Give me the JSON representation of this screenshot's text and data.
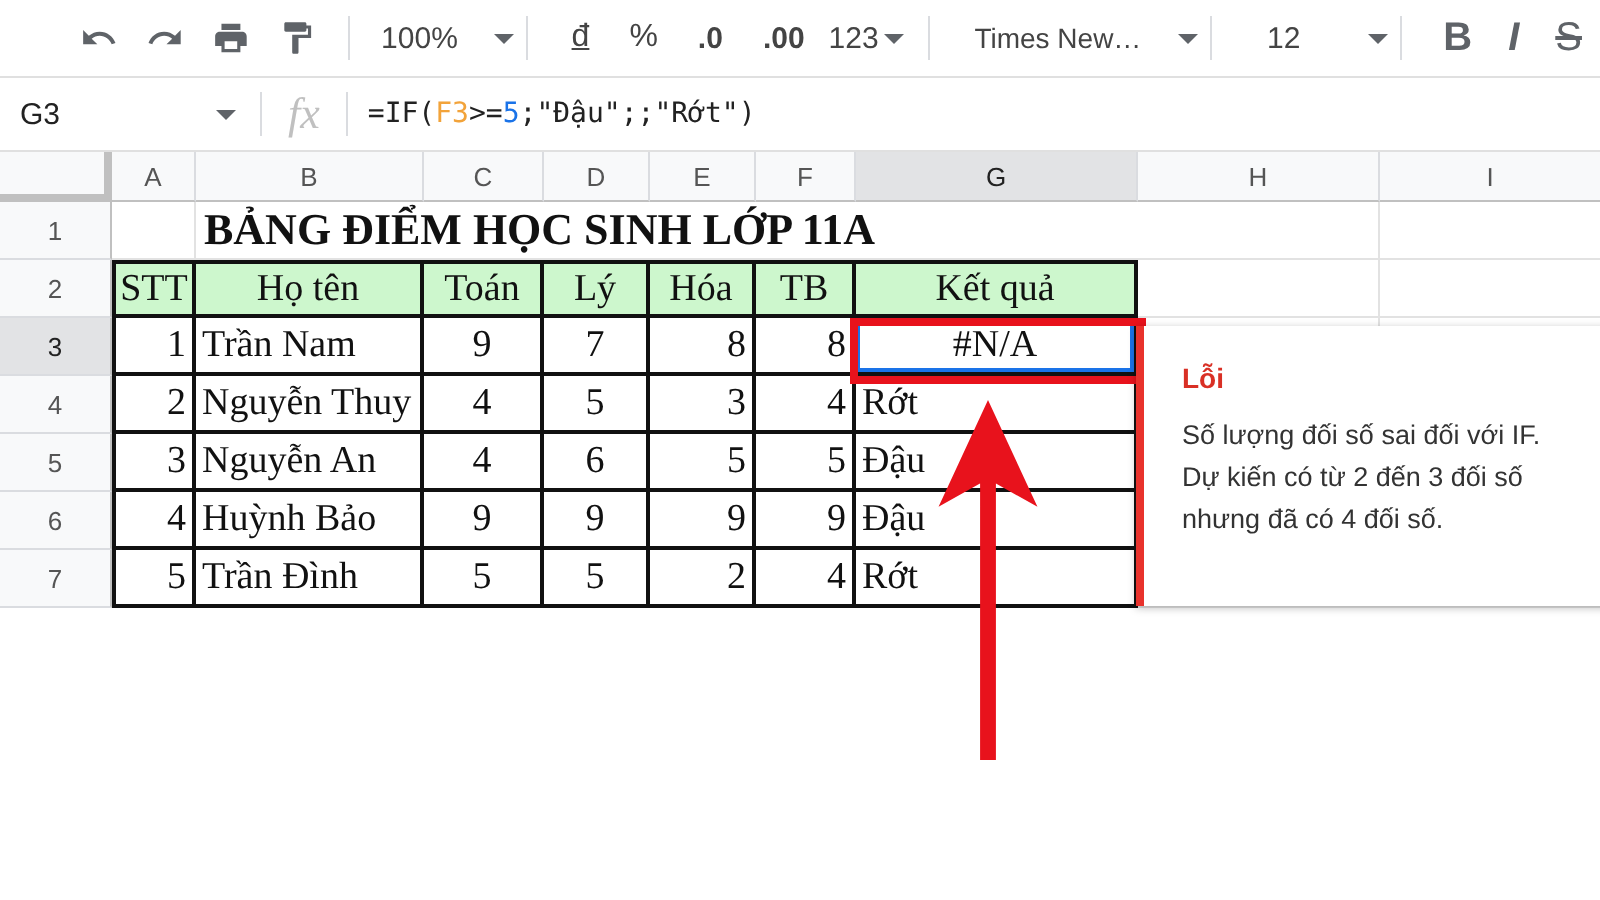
{
  "toolbar": {
    "zoom": "100%",
    "buttons": [
      {
        "label": "đ",
        "kind": "underline"
      },
      {
        "label": "%",
        "kind": "plain"
      },
      {
        "label": ".0",
        "kind": "decrease"
      },
      {
        "label": ".00",
        "kind": "increase"
      }
    ],
    "format": "123",
    "font": "Times New…",
    "size": "12",
    "styles": [
      {
        "label": "B",
        "kind": "bold"
      },
      {
        "label": "I",
        "kind": "italic"
      },
      {
        "label": "S",
        "kind": "strike"
      }
    ]
  },
  "formula_bar": {
    "name_box": "G3",
    "fx": "fx",
    "tokens": [
      {
        "text": "=IF(",
        "kind": "plain"
      },
      {
        "text": "F3",
        "kind": "ref"
      },
      {
        "text": ">=",
        "kind": "plain"
      },
      {
        "text": "5",
        "kind": "number"
      },
      {
        "text": ";\"Đậu\";;\"Rớt\")",
        "kind": "plain"
      }
    ]
  },
  "columns": [
    {
      "label": "A",
      "selected": false
    },
    {
      "label": "B",
      "selected": false
    },
    {
      "label": "C",
      "selected": false
    },
    {
      "label": "D",
      "selected": false
    },
    {
      "label": "E",
      "selected": false
    },
    {
      "label": "F",
      "selected": false
    },
    {
      "label": "G",
      "selected": true
    },
    {
      "label": "H",
      "selected": false
    },
    {
      "label": "I",
      "selected": false
    }
  ],
  "rows": [
    {
      "number": "1",
      "kind": "title",
      "selected": false,
      "title": "BẢNG ĐIỂM HỌC SINH LỚP 11A"
    },
    {
      "number": "2",
      "kind": "header",
      "selected": false,
      "cells": [
        "STT",
        "Họ tên",
        "Toán",
        "Lý",
        "Hóa",
        "TB",
        "Kết quả"
      ]
    },
    {
      "number": "3",
      "kind": "data",
      "selected": true,
      "error": true,
      "cells": [
        "1",
        "Trần Nam",
        "9",
        "7",
        "8",
        "8",
        "#N/A"
      ]
    },
    {
      "number": "4",
      "kind": "data",
      "selected": false,
      "error": false,
      "cells": [
        "2",
        "Nguyễn Thuy",
        "4",
        "5",
        "3",
        "4",
        "Rớt"
      ]
    },
    {
      "number": "5",
      "kind": "data",
      "selected": false,
      "error": false,
      "cells": [
        "3",
        "Nguyễn An",
        "4",
        "6",
        "5",
        "5",
        "Đậu"
      ]
    },
    {
      "number": "6",
      "kind": "data",
      "selected": false,
      "error": false,
      "cells": [
        "4",
        "Huỳnh Bảo",
        "9",
        "9",
        "9",
        "9",
        "Đậu"
      ]
    },
    {
      "number": "7",
      "kind": "data",
      "selected": false,
      "error": false,
      "cells": [
        "5",
        "Trần Đình",
        "5",
        "5",
        "2",
        "4",
        "Rớt"
      ]
    }
  ],
  "error_popup": {
    "title": "Lỗi",
    "message": "Số lượng đối số sai đối với IF. Dự kiến có từ 2 đến 3 đối số nhưng đã có 4 đối số."
  }
}
